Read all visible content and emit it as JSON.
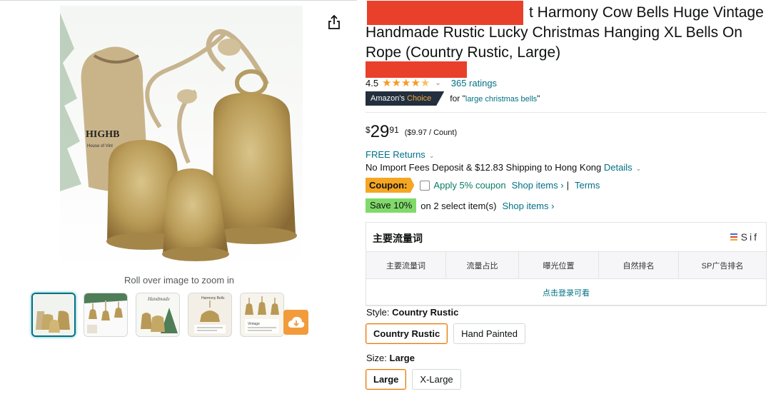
{
  "gallery": {
    "zoom_hint": "Roll over image to zoom in",
    "thumbnails": [
      "thumb-1",
      "thumb-2",
      "thumb-3",
      "thumb-4",
      "thumb-5"
    ],
    "selected_index": 0,
    "main_image": {
      "bag_brand": "HIGHB",
      "bag_subtext": "House of Vint"
    },
    "thumb_texts": {
      "thumb3": "Handmade",
      "thumb4": "Harmony Bells",
      "thumb5": "Vintage"
    }
  },
  "product": {
    "title_visible": "t Harmony Cow Bells Huge Vintage Handmade Rustic Lucky Christmas Hanging XL Bells On Rope (Country Rustic, Large)",
    "rating_value": "4.5",
    "stars": 4.5,
    "ratings_count": "365 ratings",
    "choice_badge": {
      "prefix": "Amazon's",
      "accent": "Choice"
    },
    "choice_for": "for \"",
    "choice_keyword": "large christmas bells",
    "choice_close": "\"",
    "price": {
      "symbol": "$",
      "whole": "29",
      "fraction": "91",
      "unit": "($9.97 / Count)"
    },
    "returns": "FREE Returns",
    "shipping_text": "No Import Fees Deposit & $12.83 Shipping to Hong Kong",
    "shipping_link": "Details",
    "coupon": {
      "tag": "Coupon:",
      "apply": "Apply 5% coupon",
      "shop": "Shop items ›",
      "sep": "|",
      "terms": "Terms"
    },
    "save": {
      "tag": "Save 10%",
      "text": "on 2 select item(s)",
      "shop": "Shop items ›"
    }
  },
  "plugin": {
    "title": "主要流量词",
    "logo_text": "Sif",
    "logo_colors": [
      "#3b6fd8",
      "#e8402b",
      "#f5a623"
    ],
    "columns": [
      "主要流量词",
      "流量占比",
      "曝光位置",
      "自然排名",
      "SP广告排名"
    ],
    "login_prompt": "点击登录可看"
  },
  "style_variant": {
    "label": "Style:",
    "selected": "Country Rustic",
    "options": [
      "Country Rustic",
      "Hand Painted"
    ]
  },
  "size_variant": {
    "label": "Size:",
    "selected": "Large",
    "options": [
      "Large",
      "X-Large"
    ]
  },
  "colors": {
    "link": "#007185",
    "redaction": "#e8402b",
    "star": "#f79a23",
    "coupon": "#f5a623",
    "save": "#7fda69",
    "selected_border": "#e77600"
  }
}
